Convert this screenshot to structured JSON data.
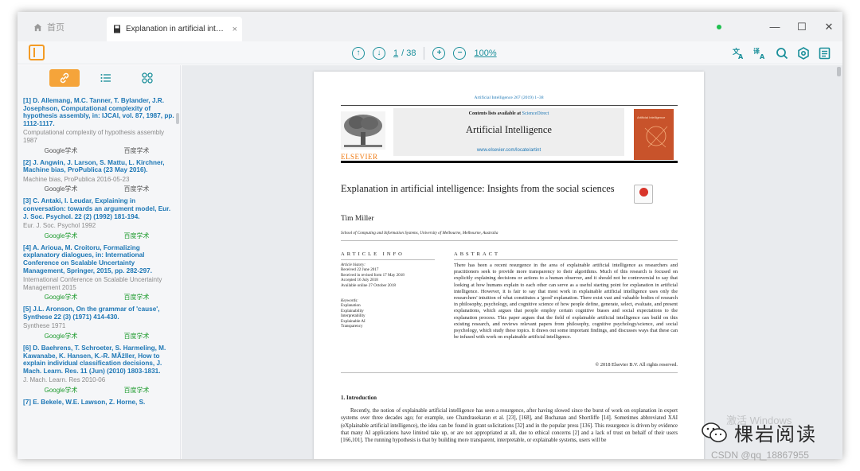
{
  "tabs": [
    {
      "label": "首页",
      "active": false
    },
    {
      "label": "Explanation in artificial intelli...",
      "active": true,
      "close": "×"
    }
  ],
  "window_controls": {
    "minimize": "—",
    "maximize": "☐",
    "close": "✕"
  },
  "toolbar": {
    "page_current": "1",
    "page_total": "/ 38",
    "zoom": "100%"
  },
  "sidebar": {
    "tabs": [
      "link",
      "list",
      "grid"
    ],
    "references": [
      {
        "title": "[1] D. Allemang, M.C. Tanner, T. Bylander, J.R. Josephson, Computational complexity of hypothesis assembly, in: IJCAI, vol. 87, 1987, pp. 1112-1117.",
        "meta": "Computational complexity of hypothesis assembly 1987",
        "google": "Google学术",
        "baidu": "百度学术",
        "green": false
      },
      {
        "title": "[2] J. Angwin, J. Larson, S. Mattu, L. Kirchner, Machine bias, ProPublica (23 May 2016).",
        "meta": "Machine bias, ProPublica 2016-05-23",
        "google": "Google学术",
        "baidu": "百度学术",
        "green": false
      },
      {
        "title": "[3] C. Antaki, I. Leudar, Explaining in conversation: towards an argument model, Eur. J. Soc. Psychol. 22 (2) (1992) 181-194.",
        "meta": "Eur. J. Soc. Psychol 1992",
        "google": "Google学术",
        "baidu": "百度学术",
        "green": true
      },
      {
        "title": "[4] A. Arioua, M. Croitoru, Formalizing explanatory dialogues, in: International Conference on Scalable Uncertainty Management, Springer, 2015, pp. 282-297.",
        "meta": "International Conference on Scalable Uncertainty Management 2015",
        "google": "Google学术",
        "baidu": "百度学术",
        "green": true
      },
      {
        "title": "[5] J.L. Aronson, On the grammar of 'cause', Synthese 22 (3) (1971) 414-430.",
        "meta": "Synthese 1971",
        "google": "Google学术",
        "baidu": "百度学术",
        "green": true
      },
      {
        "title": "[6] D. Baehrens, T. Schroeter, S. Harmeling, M. Kawanabe, K. Hansen, K.-R. MÃžller, How to explain individual classification decisions, J. Mach. Learn. Res. 11 (Jun) (2010) 1803-1831.",
        "meta": "J. Mach. Learn. Res 2010-06",
        "google": "Google学术",
        "baidu": "百度学术",
        "green": true
      },
      {
        "title": "[7] E. Bekele, W.E. Lawson, Z. Horne, S.",
        "meta": "",
        "google": "",
        "baidu": "",
        "green": false
      }
    ]
  },
  "pdf": {
    "journal_ref": "Artificial Intelligence 267 (2019) 1–38",
    "contents_prefix": "Contents lists available at ",
    "contents_link": "ScienceDirect",
    "journal_name": "Artificial Intelligence",
    "journal_url": "www.elsevier.com/locate/artint",
    "publisher": "ELSEVIER",
    "cover_title": "Artificial Intelligence",
    "title": "Explanation in artificial intelligence: Insights from the social sciences",
    "author": "Tim Miller",
    "affiliation": "School of Computing and Information Systems, University of Melbourne, Melbourne, Australia",
    "article_info_heading": "ARTICLE INFO",
    "history_label": "Article history:",
    "history": [
      "Received 22 June 2017",
      "Received in revised form 17 May 2018",
      "Accepted 16 July 2018",
      "Available online 27 October 2018"
    ],
    "keywords_label": "Keywords:",
    "keywords": [
      "Explanation",
      "Explainability",
      "Interpretability",
      "Explainable AI",
      "Transparency"
    ],
    "abstract_heading": "ABSTRACT",
    "abstract": "There has been a recent resurgence in the area of explainable artificial intelligence as researchers and practitioners seek to provide more transparency to their algorithms. Much of this research is focused on explicitly explaining decisions or actions to a human observer, and it should not be controversial to say that looking at how humans explain to each other can serve as a useful starting point for explanation in artificial intelligence. However, it is fair to say that most work in explainable artificial intelligence uses only the researchers' intuition of what constitutes a 'good' explanation. There exist vast and valuable bodies of research in philosophy, psychology, and cognitive science of how people define, generate, select, evaluate, and present explanations, which argues that people employ certain cognitive biases and social expectations to the explanation process. This paper argues that the field of explainable artificial intelligence can build on this existing research, and reviews relevant papers from philosophy, cognitive psychology/science, and social psychology, which study these topics. It draws out some important findings, and discusses ways that these can be infused with work on explainable artificial intelligence.",
    "copyright": "© 2018 Elsevier B.V. All rights reserved.",
    "intro_heading": "1. Introduction",
    "intro_text": "Recently, the notion of explainable artificial intelligence has seen a resurgence, after having slowed since the burst of work on explanation in expert systems over three decades ago; for example, see Chandrasekaran et al. [23], [168], and Buchanan and Shortliffe [14]. Sometimes abbreviated XAI (eXplainable artificial intelligence), the idea can be found in grant solicitations [32] and in the popular press [136]. This resurgence is driven by evidence that many AI applications have limited take up, or are not appropriated at all, due to ethical concerns [2] and a lack of trust on behalf of their users [166,101]. The running hypothesis is that by building more transparent, interpretable, or explainable systems, users will be"
  },
  "watermarks": {
    "windows": "激活 Windows",
    "brand": "棵岩阅读",
    "csdn": "CSDN @qq_18867955"
  },
  "colors": {
    "accent": "#1a8f9a",
    "highlight": "#f5a43a",
    "link": "#1d77b5",
    "elsevier": "#f07b13"
  }
}
